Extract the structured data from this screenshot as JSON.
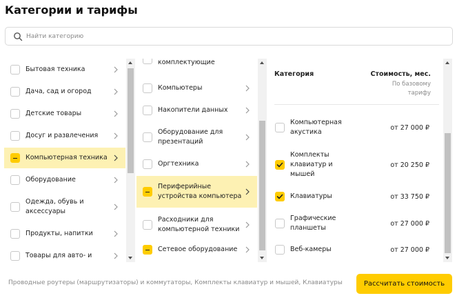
{
  "title": "Категории и тарифы",
  "search": {
    "placeholder": "Найти категорию",
    "icon": "search-icon"
  },
  "col1": {
    "items": [
      {
        "label": "Бытовая техника",
        "state": "none"
      },
      {
        "label": "Дача, сад и огород",
        "state": "none"
      },
      {
        "label": "Детские товары",
        "state": "none"
      },
      {
        "label": "Досуг и развлечения",
        "state": "none"
      },
      {
        "label": "Компьютерная техника",
        "state": "partial",
        "active": true
      },
      {
        "label": "Оборудование",
        "state": "none"
      },
      {
        "label": "Одежда, обувь и\nаксессуары",
        "state": "none"
      },
      {
        "label": "Продукты, напитки",
        "state": "none"
      },
      {
        "label": "Товары для авто- и",
        "state": "none"
      }
    ]
  },
  "col2": {
    "items": [
      {
        "label": "комплектующие",
        "state": "none"
      },
      {
        "label": "Компьютеры",
        "state": "none"
      },
      {
        "label": "Накопители данных",
        "state": "none"
      },
      {
        "label": "Оборудование для\nпрезентаций",
        "state": "none"
      },
      {
        "label": "Оргтехника",
        "state": "none"
      },
      {
        "label": "Периферийные\nустройства компьютера",
        "state": "partial",
        "active": true
      },
      {
        "label": "Расходники для\nкомпьютерной техники",
        "state": "none"
      },
      {
        "label": "Сетевое оборудование",
        "state": "partial"
      }
    ]
  },
  "col3": {
    "header_category": "Категория",
    "header_cost": "Стоимость, мес.",
    "header_sub": "По базовому\nтарифу",
    "items": [
      {
        "label": "Компьютерная\nакустика",
        "price": "от 27 000 ₽",
        "checked": false
      },
      {
        "label": "Комплекты\nклавиатур и\nмышей",
        "price": "от 20 250 ₽",
        "checked": true
      },
      {
        "label": "Клавиатуры",
        "price": "от 33 750 ₽",
        "checked": true
      },
      {
        "label": "Графические\nпланшеты",
        "price": "от 27 000 ₽",
        "checked": false
      },
      {
        "label": "Веб-камеры",
        "price": "от 27 000 ₽",
        "checked": false
      }
    ]
  },
  "footer": {
    "selected_text": "Проводные роутеры (маршрутизаторы) и коммутаторы, Комплекты клавиатур и мышей, Клавиатуры",
    "calc_label": "Рассчитать стоимость"
  },
  "colors": {
    "accent": "#ffcc00",
    "active_row": "#fdf1b3"
  }
}
